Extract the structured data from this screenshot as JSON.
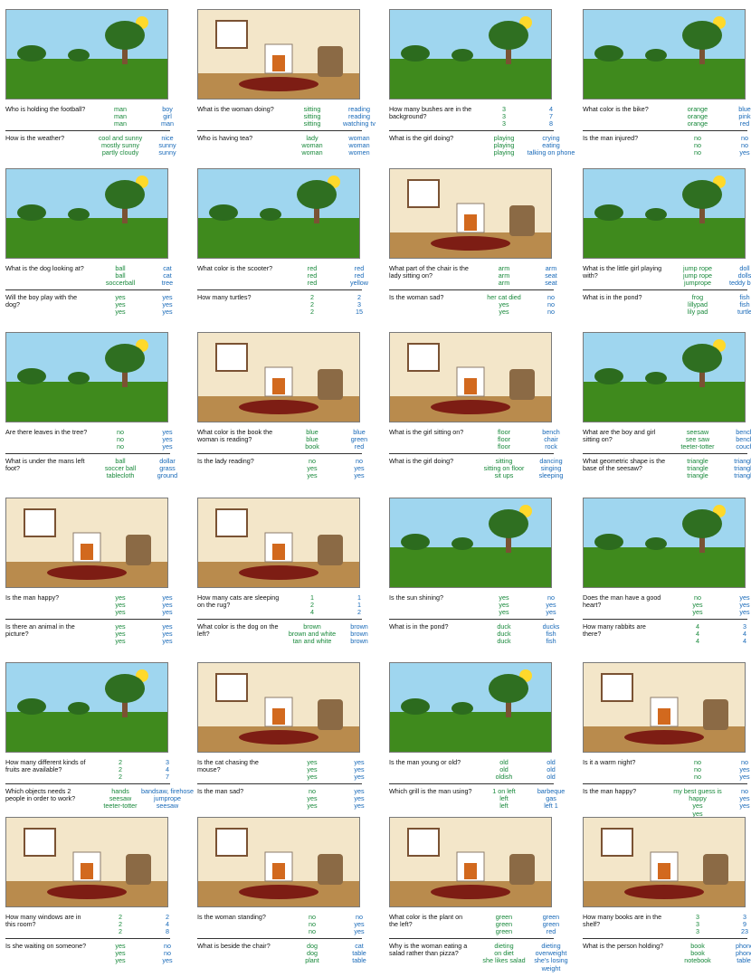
{
  "colors": {
    "green_answer": "#17883a",
    "blue_answer": "#1869b8"
  },
  "panels": [
    {
      "scene": "park",
      "qa": [
        {
          "q": "Who is holding the football?",
          "g": [
            "man",
            "man",
            "man"
          ],
          "b": [
            "boy",
            "girl",
            "man"
          ]
        },
        {
          "q": "How is the weather?",
          "g": [
            "cool and sunny",
            "mostly sunny",
            "partly cloudy"
          ],
          "b": [
            "nice",
            "sunny",
            "sunny"
          ]
        }
      ]
    },
    {
      "scene": "room",
      "qa": [
        {
          "q": "What is the woman doing?",
          "g": [
            "sitting",
            "sitting",
            "sitting"
          ],
          "b": [
            "reading",
            "reading",
            "watching tv"
          ]
        },
        {
          "q": "Who is having tea?",
          "g": [
            "lady",
            "woman",
            "woman"
          ],
          "b": [
            "woman",
            "woman",
            "women"
          ]
        }
      ]
    },
    {
      "scene": "park",
      "qa": [
        {
          "q": "How many bushes are in the background?",
          "g": [
            "3",
            "3",
            "3"
          ],
          "b": [
            "4",
            "7",
            "8"
          ]
        },
        {
          "q": "What is the girl doing?",
          "g": [
            "playing",
            "playing",
            "playing"
          ],
          "b": [
            "crying",
            "eating",
            "talking on phone"
          ]
        }
      ]
    },
    {
      "scene": "park",
      "qa": [
        {
          "q": "What color is the bike?",
          "g": [
            "orange",
            "orange",
            "orange"
          ],
          "b": [
            "blue",
            "pink",
            "red"
          ]
        },
        {
          "q": "Is the man injured?",
          "g": [
            "no",
            "no",
            "no"
          ],
          "b": [
            "no",
            "no",
            "yes"
          ]
        }
      ]
    },
    {
      "scene": "park",
      "qa": [
        {
          "q": "What is the dog looking at?",
          "g": [
            "ball",
            "ball",
            "soccerball"
          ],
          "b": [
            "cat",
            "cat",
            "tree"
          ]
        },
        {
          "q": "Will the boy play with the dog?",
          "g": [
            "yes",
            "yes",
            "yes"
          ],
          "b": [
            "yes",
            "yes",
            "yes"
          ]
        }
      ]
    },
    {
      "scene": "park",
      "qa": [
        {
          "q": "What color is the scooter?",
          "g": [
            "red",
            "red",
            "red"
          ],
          "b": [
            "red",
            "red",
            "yellow"
          ]
        },
        {
          "q": "How many turtles?",
          "g": [
            "2",
            "2",
            "2"
          ],
          "b": [
            "2",
            "3",
            "15"
          ]
        }
      ]
    },
    {
      "scene": "room",
      "qa": [
        {
          "q": "What part of the chair is the lady sitting on?",
          "g": [
            "arm",
            "arm",
            "arm"
          ],
          "b": [
            "arm",
            "seat",
            "seat"
          ]
        },
        {
          "q": "Is the woman sad?",
          "g": [
            "her cat died",
            "yes",
            "yes"
          ],
          "b": [
            "no",
            "no",
            "no"
          ]
        }
      ]
    },
    {
      "scene": "park",
      "qa": [
        {
          "q": "What is the little girl playing with?",
          "g": [
            "jump rope",
            "jump rope",
            "jumprope"
          ],
          "b": [
            "doll",
            "dolls",
            "teddy bear"
          ]
        },
        {
          "q": "What is in the pond?",
          "g": [
            "frog",
            "lillypad",
            "lily pad"
          ],
          "b": [
            "fish",
            "fish",
            "turtle"
          ]
        }
      ]
    },
    {
      "scene": "park",
      "qa": [
        {
          "q": "Are there leaves in the tree?",
          "g": [
            "no",
            "no",
            "no"
          ],
          "b": [
            "yes",
            "yes",
            "yes"
          ]
        },
        {
          "q": "What is under the mans left foot?",
          "g": [
            "ball",
            "soccer ball",
            "tablecloth"
          ],
          "b": [
            "dollar",
            "grass",
            "ground"
          ]
        }
      ]
    },
    {
      "scene": "room",
      "qa": [
        {
          "q": "What color is the book the woman is reading?",
          "g": [
            "blue",
            "blue",
            "book"
          ],
          "b": [
            "blue",
            "green",
            "red"
          ]
        },
        {
          "q": "Is the lady reading?",
          "g": [
            "no",
            "yes",
            "yes"
          ],
          "b": [
            "no",
            "yes",
            "yes"
          ]
        }
      ]
    },
    {
      "scene": "room",
      "qa": [
        {
          "q": "What is the girl sitting on?",
          "g": [
            "floor",
            "floor",
            "floor"
          ],
          "b": [
            "bench",
            "chair",
            "rock"
          ]
        },
        {
          "q": "What is the girl doing?",
          "g": [
            "sitting",
            "sitting on floor",
            "sit ups"
          ],
          "b": [
            "dancing",
            "singing",
            "sleeping"
          ]
        }
      ]
    },
    {
      "scene": "park",
      "qa": [
        {
          "q": "What are the boy and girl sitting on?",
          "g": [
            "seesaw",
            "see saw",
            "teeter-totter"
          ],
          "b": [
            "bench",
            "bench",
            "couch"
          ]
        },
        {
          "q": "What geometric shape is the base of the seesaw?",
          "g": [
            "triangle",
            "triangle",
            "triangle"
          ],
          "b": [
            "triangle",
            "triangle",
            "triangle"
          ]
        }
      ]
    },
    {
      "scene": "room",
      "qa": [
        {
          "q": "Is the man happy?",
          "g": [
            "yes",
            "yes",
            "yes"
          ],
          "b": [
            "yes",
            "yes",
            "yes"
          ]
        },
        {
          "q": "Is there an animal in the picture?",
          "g": [
            "yes",
            "yes",
            "yes"
          ],
          "b": [
            "yes",
            "yes",
            "yes"
          ]
        }
      ]
    },
    {
      "scene": "room",
      "qa": [
        {
          "q": "How many cats are sleeping on the rug?",
          "g": [
            "1",
            "2",
            "4"
          ],
          "b": [
            "1",
            "1",
            "2"
          ]
        },
        {
          "q": "What color is the dog on the left?",
          "g": [
            "brown",
            "brown and white",
            "tan and white"
          ],
          "b": [
            "brown",
            "brown",
            "brown"
          ]
        }
      ]
    },
    {
      "scene": "park",
      "qa": [
        {
          "q": "Is the sun shining?",
          "g": [
            "yes",
            "yes",
            "yes"
          ],
          "b": [
            "no",
            "yes",
            "yes"
          ]
        },
        {
          "q": "What is in the pond?",
          "g": [
            "duck",
            "duck",
            "duck"
          ],
          "b": [
            "ducks",
            "fish",
            "fish"
          ]
        }
      ]
    },
    {
      "scene": "park",
      "qa": [
        {
          "q": "Does the man have a good heart?",
          "g": [
            "no",
            "yes",
            "yes"
          ],
          "b": [
            "yes",
            "yes",
            "yes"
          ]
        },
        {
          "q": "How many rabbits are there?",
          "g": [
            "4",
            "4",
            "4"
          ],
          "b": [
            "3",
            "4",
            "4"
          ]
        }
      ]
    },
    {
      "scene": "park",
      "qa": [
        {
          "q": "How many different kinds of fruits are available?",
          "g": [
            "2",
            "2",
            "2"
          ],
          "b": [
            "3",
            "4",
            "7"
          ]
        },
        {
          "q": "Which objects needs 2 people in order to work?",
          "g": [
            "hands",
            "seesaw",
            "teeter-totter"
          ],
          "b": [
            "bandsaw, firehose",
            "jumprope",
            "seesaw"
          ]
        }
      ]
    },
    {
      "scene": "room",
      "qa": [
        {
          "q": "Is the cat chasing the mouse?",
          "g": [
            "yes",
            "yes",
            "yes"
          ],
          "b": [
            "yes",
            "yes",
            "yes"
          ]
        },
        {
          "q": "Is the man sad?",
          "g": [
            "no",
            "yes",
            "yes"
          ],
          "b": [
            "yes",
            "yes",
            "yes"
          ]
        }
      ]
    },
    {
      "scene": "park",
      "qa": [
        {
          "q": "Is the man young or old?",
          "g": [
            "old",
            "old",
            "oldish"
          ],
          "b": [
            "old",
            "old",
            "old"
          ]
        },
        {
          "q": "Which grill is the man using?",
          "g": [
            "1 on left",
            "left",
            "left"
          ],
          "b": [
            "barbeque",
            "gas",
            "left 1"
          ]
        }
      ]
    },
    {
      "scene": "room",
      "qa": [
        {
          "q": "Is it a warm night?",
          "g": [
            "no",
            "no",
            "no"
          ],
          "b": [
            "no",
            "yes",
            "yes"
          ]
        },
        {
          "q": "Is the man happy?",
          "g": [
            "my best guess is happy",
            "yes",
            "yes"
          ],
          "b": [
            "no",
            "yes",
            "yes"
          ]
        }
      ]
    },
    {
      "scene": "room",
      "qa": [
        {
          "q": "How many windows are in this room?",
          "g": [
            "2",
            "2",
            "2"
          ],
          "b": [
            "2",
            "4",
            "8"
          ]
        },
        {
          "q": "Is she waiting on someone?",
          "g": [
            "yes",
            "yes",
            "yes"
          ],
          "b": [
            "no",
            "no",
            "yes"
          ]
        }
      ]
    },
    {
      "scene": "room",
      "qa": [
        {
          "q": "Is the woman standing?",
          "g": [
            "no",
            "no",
            "no"
          ],
          "b": [
            "no",
            "yes",
            "yes"
          ]
        },
        {
          "q": "What is beside the chair?",
          "g": [
            "dog",
            "dog",
            "plant"
          ],
          "b": [
            "cat",
            "table",
            "table"
          ]
        }
      ]
    },
    {
      "scene": "room",
      "qa": [
        {
          "q": "What color is the plant on the left?",
          "g": [
            "green",
            "green",
            "green"
          ],
          "b": [
            "green",
            "green",
            "red"
          ]
        },
        {
          "q": "Why is the woman eating a salad rather than pizza?",
          "g": [
            "dieting",
            "on diet",
            "she likes salad"
          ],
          "b": [
            "dieting",
            "overweight",
            "she's losing weight"
          ]
        }
      ]
    },
    {
      "scene": "room",
      "qa": [
        {
          "q": "How many books are in the shelf?",
          "g": [
            "3",
            "3",
            "3"
          ],
          "b": [
            "3",
            "9",
            "23"
          ]
        },
        {
          "q": "What is the person holding?",
          "g": [
            "book",
            "book",
            "notebook"
          ],
          "b": [
            "phone",
            "phone",
            "tablet"
          ]
        }
      ]
    }
  ]
}
